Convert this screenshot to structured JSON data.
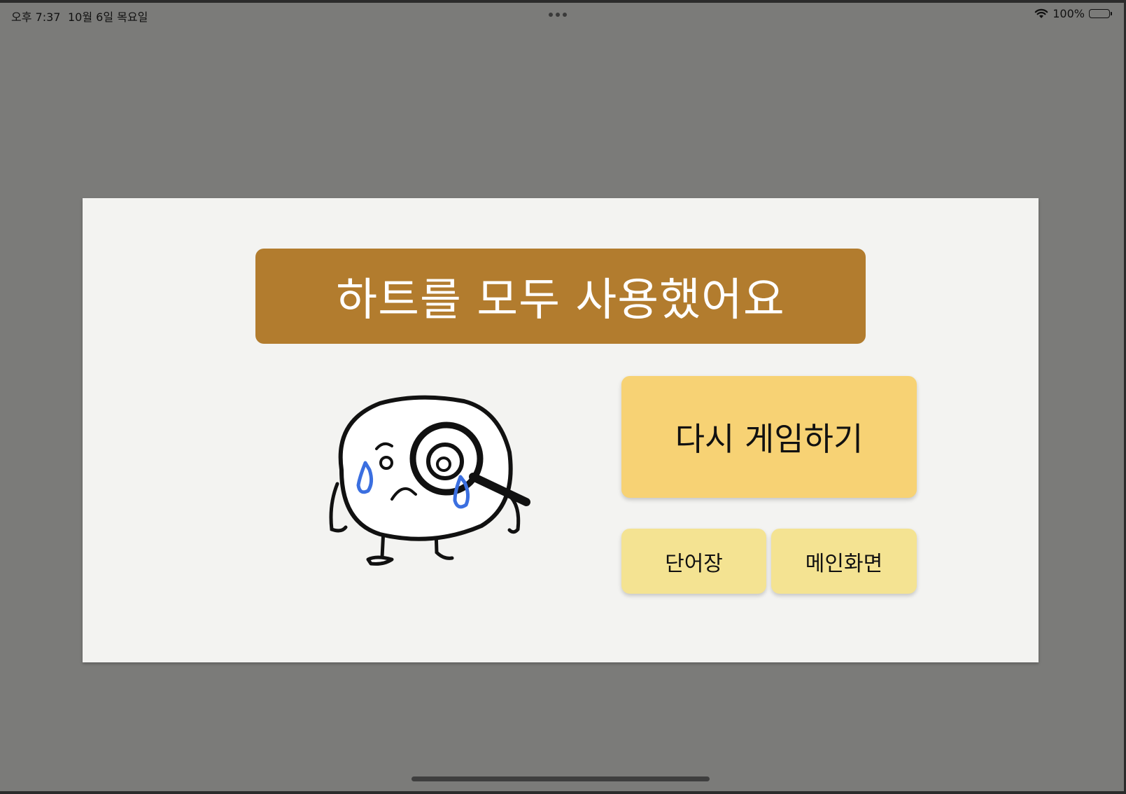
{
  "status_bar": {
    "time": "오후 7:37",
    "date": "10월 6일 목요일",
    "battery": "100%",
    "wifi_icon": "wifi-icon",
    "battery_icon": "battery-icon"
  },
  "dialog": {
    "title": "하트를 모두 사용했어요",
    "mascot": "crying-mascot-with-magnifier",
    "buttons": {
      "retry": "다시 게임하기",
      "vocab": "단어장",
      "main": "메인화면"
    }
  },
  "colors": {
    "overlay": "#7b7b79",
    "dialog_bg": "#f3f3f1",
    "banner": "#b27c2e",
    "retry_button": "#f7d274",
    "secondary_button": "#f4e392",
    "tear": "#3b6fe0"
  }
}
